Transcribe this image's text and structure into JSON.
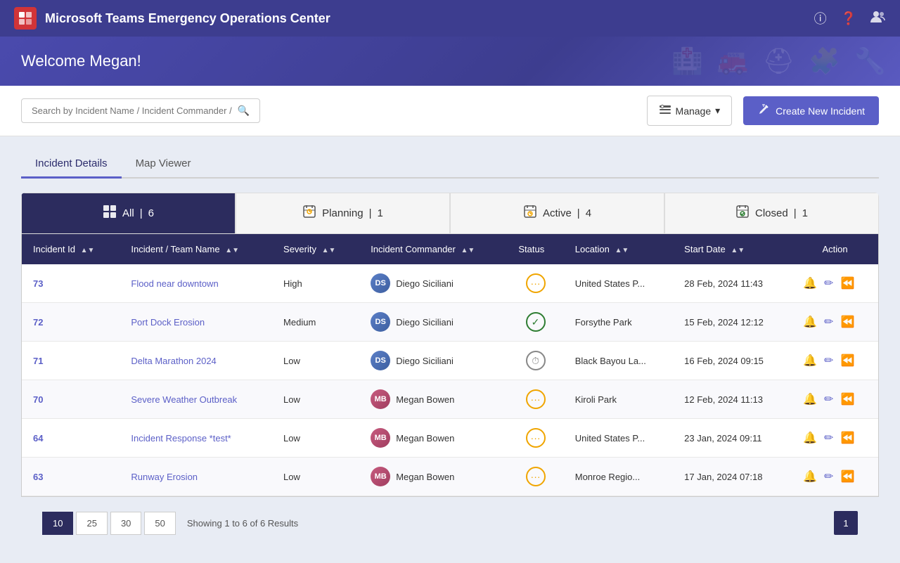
{
  "app": {
    "title": "Microsoft Teams Emergency Operations Center",
    "icon": "+"
  },
  "header": {
    "icons": [
      "ℹ",
      "?",
      "👤"
    ]
  },
  "welcome": {
    "text": "Welcome Megan!"
  },
  "toolbar": {
    "search_placeholder": "Search by Incident Name / Incident Commander / Location / Severity",
    "manage_label": "Manage",
    "create_label": "Create New Incident"
  },
  "view_tabs": [
    {
      "label": "Incident Details",
      "active": true
    },
    {
      "label": "Map Viewer",
      "active": false
    }
  ],
  "status_tabs": [
    {
      "label": "All",
      "count": "6",
      "icon": "⊞",
      "active": true
    },
    {
      "label": "Planning",
      "count": "1",
      "icon": "📋",
      "active": false
    },
    {
      "label": "Active",
      "count": "4",
      "icon": "⏱",
      "active": false
    },
    {
      "label": "Closed",
      "count": "1",
      "icon": "📁",
      "active": false
    }
  ],
  "table": {
    "columns": [
      {
        "key": "id",
        "label": "Incident Id"
      },
      {
        "key": "name",
        "label": "Incident / Team Name"
      },
      {
        "key": "severity",
        "label": "Severity"
      },
      {
        "key": "commander",
        "label": "Incident Commander"
      },
      {
        "key": "status",
        "label": "Status"
      },
      {
        "key": "location",
        "label": "Location"
      },
      {
        "key": "startDate",
        "label": "Start Date"
      },
      {
        "key": "action",
        "label": "Action"
      }
    ],
    "rows": [
      {
        "id": "73",
        "name": "Flood near downtown",
        "severity": "High",
        "commander": "Diego Siciliani",
        "commander_type": "diego",
        "status_type": "active",
        "location": "United States P...",
        "startDate": "28 Feb, 2024 11:43"
      },
      {
        "id": "72",
        "name": "Port Dock Erosion",
        "severity": "Medium",
        "commander": "Diego Siciliani",
        "commander_type": "diego",
        "status_type": "closed",
        "location": "Forsythe Park",
        "startDate": "15 Feb, 2024 12:12"
      },
      {
        "id": "71",
        "name": "Delta Marathon 2024",
        "severity": "Low",
        "commander": "Diego Siciliani",
        "commander_type": "diego",
        "status_type": "planning",
        "location": "Black Bayou La...",
        "startDate": "16 Feb, 2024 09:15"
      },
      {
        "id": "70",
        "name": "Severe Weather Outbreak",
        "severity": "Low",
        "commander": "Megan Bowen",
        "commander_type": "megan",
        "status_type": "active",
        "location": "Kiroli Park",
        "startDate": "12 Feb, 2024 11:13"
      },
      {
        "id": "64",
        "name": "Incident Response *test*",
        "severity": "Low",
        "commander": "Megan Bowen",
        "commander_type": "megan",
        "status_type": "active",
        "location": "United States P...",
        "startDate": "23 Jan, 2024 09:11"
      },
      {
        "id": "63",
        "name": "Runway Erosion",
        "severity": "Low",
        "commander": "Megan Bowen",
        "commander_type": "megan",
        "status_type": "active",
        "location": "Monroe Regio...",
        "startDate": "17 Jan, 2024 07:18"
      }
    ]
  },
  "pagination": {
    "page_sizes": [
      "10",
      "25",
      "30",
      "50"
    ],
    "active_page_size": "10",
    "showing_text": "Showing 1 to 6 of 6 Results",
    "current_page": "1"
  }
}
